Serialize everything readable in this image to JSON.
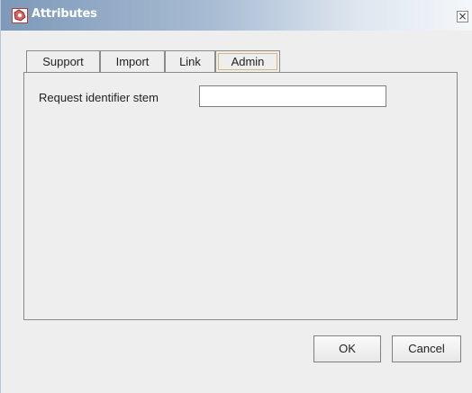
{
  "window": {
    "title": "Attributes",
    "title_icon": "app-icon",
    "close_glyph": "×"
  },
  "tabs": [
    {
      "label": "Support",
      "active": false
    },
    {
      "label": "Import",
      "active": false
    },
    {
      "label": "Link",
      "active": false
    },
    {
      "label": "Admin",
      "active": true
    }
  ],
  "admin": {
    "request_identifier_stem_label": "Request identifier stem",
    "request_identifier_stem_value": ""
  },
  "buttons": {
    "ok_label": "OK",
    "cancel_label": "Cancel"
  },
  "colors": {
    "titlebar_start": "#7d99b9",
    "titlebar_end": "#f4f7fa",
    "active_tab_focus": "#d9b67a",
    "window_background": "#eeeeee"
  }
}
